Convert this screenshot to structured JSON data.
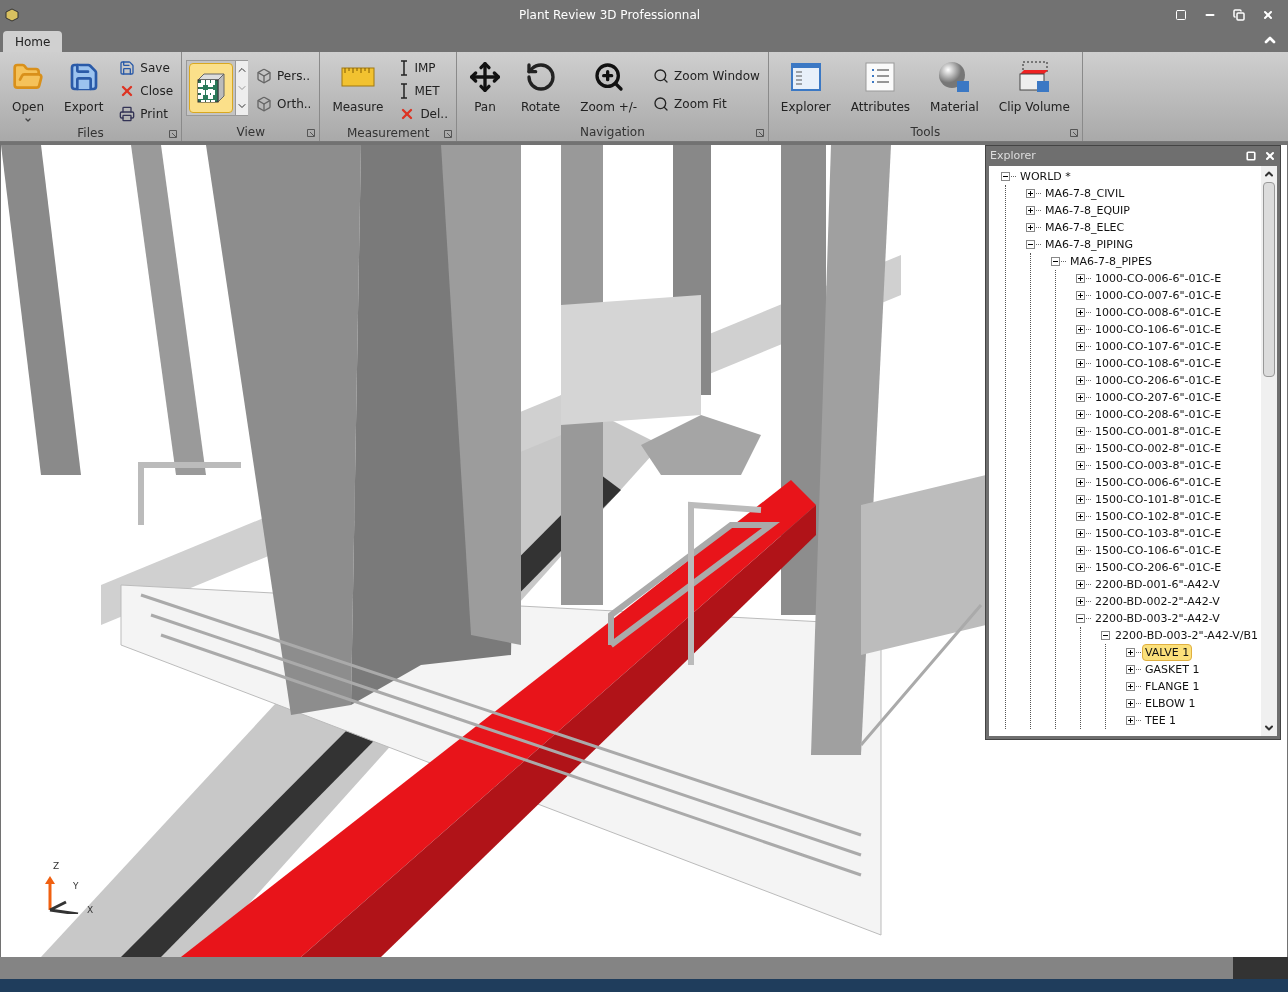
{
  "window": {
    "title": "Plant Review 3D Professionnal"
  },
  "tabs": [
    {
      "label": "Home",
      "selected": true
    }
  ],
  "ribbon": [
    {
      "name": "Files",
      "buttons": [
        {
          "label": "Open",
          "kind": "large",
          "dropdown": true
        },
        {
          "label": "Export",
          "kind": "large"
        },
        {
          "label": "Save",
          "kind": "small"
        },
        {
          "label": "Close",
          "kind": "small"
        },
        {
          "label": "Print",
          "kind": "small"
        }
      ]
    },
    {
      "name": "View",
      "buttons": [
        {
          "kind": "gallery",
          "selected": true
        },
        {
          "label": "Pers..",
          "kind": "small"
        },
        {
          "label": "Orth..",
          "kind": "small"
        }
      ]
    },
    {
      "name": "Measurement",
      "buttons": [
        {
          "label": "Measure",
          "kind": "large"
        },
        {
          "label": "IMP",
          "kind": "small"
        },
        {
          "label": "MET",
          "kind": "small"
        },
        {
          "label": "Del..",
          "kind": "small"
        }
      ]
    },
    {
      "name": "Navigation",
      "buttons": [
        {
          "label": "Pan",
          "kind": "large"
        },
        {
          "label": "Rotate",
          "kind": "large"
        },
        {
          "label": "Zoom +/-",
          "kind": "large"
        },
        {
          "label": "Zoom Window",
          "kind": "small"
        },
        {
          "label": "Zoom Fit",
          "kind": "small"
        }
      ]
    },
    {
      "name": "Tools",
      "buttons": [
        {
          "label": "Explorer",
          "kind": "large"
        },
        {
          "label": "Attributes",
          "kind": "large"
        },
        {
          "label": "Material",
          "kind": "large"
        },
        {
          "label": "Clip Volume",
          "kind": "large"
        }
      ]
    }
  ],
  "viewport": {
    "axes": [
      "Z",
      "Y",
      "X"
    ]
  },
  "explorer": {
    "title": "Explorer",
    "tree": [
      {
        "label": "WORLD *",
        "expanded": true,
        "selected": false,
        "children": [
          {
            "label": "MA6-7-8_CIVIL",
            "expanded": false,
            "selected": false
          },
          {
            "label": "MA6-7-8_EQUIP",
            "expanded": false,
            "selected": false
          },
          {
            "label": "MA6-7-8_ELEC",
            "expanded": false,
            "selected": false
          },
          {
            "label": "MA6-7-8_PIPING",
            "expanded": true,
            "selected": false,
            "children": [
              {
                "label": "MA6-7-8_PIPES",
                "expanded": true,
                "selected": false,
                "children": [
                  {
                    "label": "1000-CO-006-6\"-01C-E",
                    "expanded": false,
                    "selected": false
                  },
                  {
                    "label": "1000-CO-007-6\"-01C-E",
                    "expanded": false,
                    "selected": false
                  },
                  {
                    "label": "1000-CO-008-6\"-01C-E",
                    "expanded": false,
                    "selected": false
                  },
                  {
                    "label": "1000-CO-106-6\"-01C-E",
                    "expanded": false,
                    "selected": false
                  },
                  {
                    "label": "1000-CO-107-6\"-01C-E",
                    "expanded": false,
                    "selected": false
                  },
                  {
                    "label": "1000-CO-108-6\"-01C-E",
                    "expanded": false,
                    "selected": false
                  },
                  {
                    "label": "1000-CO-206-6\"-01C-E",
                    "expanded": false,
                    "selected": false
                  },
                  {
                    "label": "1000-CO-207-6\"-01C-E",
                    "expanded": false,
                    "selected": false
                  },
                  {
                    "label": "1000-CO-208-6\"-01C-E",
                    "expanded": false,
                    "selected": false
                  },
                  {
                    "label": "1500-CO-001-8\"-01C-E",
                    "expanded": false,
                    "selected": false
                  },
                  {
                    "label": "1500-CO-002-8\"-01C-E",
                    "expanded": false,
                    "selected": false
                  },
                  {
                    "label": "1500-CO-003-8\"-01C-E",
                    "expanded": false,
                    "selected": false
                  },
                  {
                    "label": "1500-CO-006-6\"-01C-E",
                    "expanded": false,
                    "selected": false
                  },
                  {
                    "label": "1500-CO-101-8\"-01C-E",
                    "expanded": false,
                    "selected": false
                  },
                  {
                    "label": "1500-CO-102-8\"-01C-E",
                    "expanded": false,
                    "selected": false
                  },
                  {
                    "label": "1500-CO-103-8\"-01C-E",
                    "expanded": false,
                    "selected": false
                  },
                  {
                    "label": "1500-CO-106-6\"-01C-E",
                    "expanded": false,
                    "selected": false
                  },
                  {
                    "label": "1500-CO-206-6\"-01C-E",
                    "expanded": false,
                    "selected": false
                  },
                  {
                    "label": "2200-BD-001-6\"-A42-V",
                    "expanded": false,
                    "selected": false
                  },
                  {
                    "label": "2200-BD-002-2\"-A42-V",
                    "expanded": false,
                    "selected": false
                  },
                  {
                    "label": "2200-BD-003-2\"-A42-V",
                    "expanded": true,
                    "selected": false,
                    "children": [
                      {
                        "label": "2200-BD-003-2\"-A42-V/B1",
                        "expanded": true,
                        "selected": false,
                        "children": [
                          {
                            "label": "VALVE 1",
                            "expanded": false,
                            "selected": true
                          },
                          {
                            "label": "GASKET 1",
                            "expanded": false,
                            "selected": false
                          },
                          {
                            "label": "FLANGE 1",
                            "expanded": false,
                            "selected": false
                          },
                          {
                            "label": "ELBOW 1",
                            "expanded": false,
                            "selected": false
                          },
                          {
                            "label": "TEE 1",
                            "expanded": false,
                            "selected": false
                          }
                        ]
                      }
                    ]
                  }
                ]
              }
            ]
          }
        ]
      }
    ]
  }
}
